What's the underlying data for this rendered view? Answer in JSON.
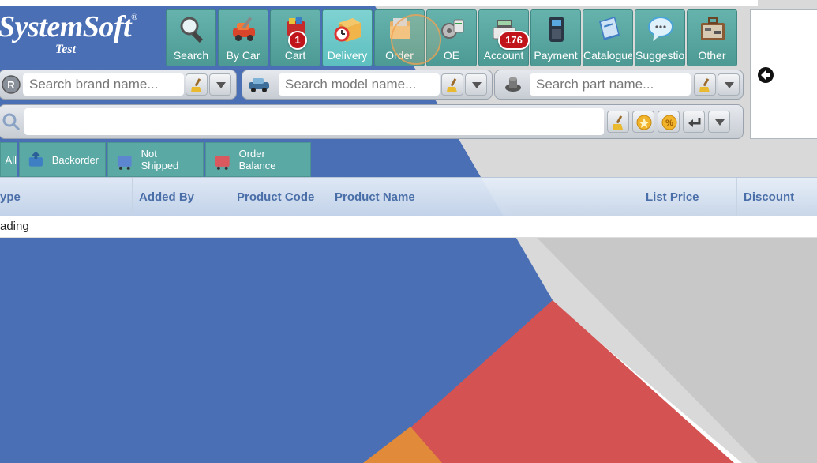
{
  "brand": {
    "name": "SystemSoft",
    "registered": "®",
    "subtitle": "Test"
  },
  "toolbar": [
    {
      "label": "Search",
      "icon": "magnifier-icon",
      "badge": ""
    },
    {
      "label": "By Car",
      "icon": "car-tools-icon",
      "badge": ""
    },
    {
      "label": "Cart",
      "icon": "cart-icon",
      "badge": "1"
    },
    {
      "label": "Delivery",
      "icon": "delivery-box-icon",
      "badge": ""
    },
    {
      "label": "Order",
      "icon": "order-folder-icon",
      "badge": ""
    },
    {
      "label": "OE",
      "icon": "oe-parts-icon",
      "badge": ""
    },
    {
      "label": "Account",
      "icon": "cash-register-icon",
      "badge": "176"
    },
    {
      "label": "Payment",
      "icon": "card-terminal-icon",
      "badge": ""
    },
    {
      "label": "Catalogue",
      "icon": "catalogue-book-icon",
      "badge": ""
    },
    {
      "label": "Suggestion",
      "icon": "speech-bubble-icon",
      "badge": ""
    },
    {
      "label": "Other",
      "icon": "toolbox-icon",
      "badge": ""
    }
  ],
  "search": {
    "brand_placeholder": "Search brand name...",
    "model_placeholder": "Search model name...",
    "part_placeholder": "Search part name...",
    "main_value": ""
  },
  "filters": [
    {
      "label": "All"
    },
    {
      "label": "Backorder"
    },
    {
      "label": "Not Shipped"
    },
    {
      "label": "Order Balance"
    }
  ],
  "table": {
    "columns": [
      "ype",
      "Added By",
      "Product Code",
      "Product Name",
      "List Price",
      "Discount"
    ],
    "status": "ading"
  },
  "colors": {
    "teal": "#5ba9a5",
    "blue": "#4a6fb5",
    "red": "#d45352",
    "badge": "#c0141a"
  }
}
